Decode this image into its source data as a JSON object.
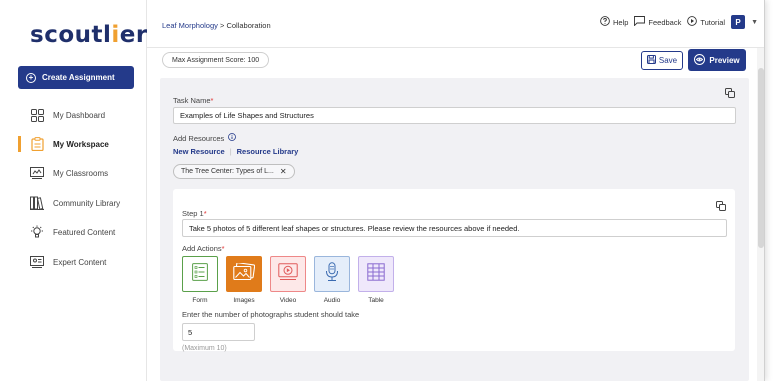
{
  "app": {
    "logo_text": "scoutlier"
  },
  "sidebar": {
    "create_label": "Create Assignment",
    "items": [
      {
        "label": "My Dashboard",
        "icon": "grid-icon",
        "active": false
      },
      {
        "label": "My Workspace",
        "icon": "clipboard-icon",
        "active": true
      },
      {
        "label": "My Classrooms",
        "icon": "classroom-icon",
        "active": false
      },
      {
        "label": "Community Library",
        "icon": "library-icon",
        "active": false
      },
      {
        "label": "Featured Content",
        "icon": "lightbulb-icon",
        "active": false
      },
      {
        "label": "Expert Content",
        "icon": "expert-icon",
        "active": false
      }
    ]
  },
  "header": {
    "breadcrumb_link": "Leaf Morphology",
    "breadcrumb_sep": ">",
    "breadcrumb_current": "Collaboration",
    "help_label": "Help",
    "feedback_label": "Feedback",
    "tutorial_label": "Tutorial",
    "avatar_initial": "P"
  },
  "toolbar": {
    "max_score_label": "Max Assignment Score: 100",
    "save_label": "Save",
    "preview_label": "Preview"
  },
  "task": {
    "name_label": "Task Name",
    "name_value": "Examples of Life Shapes and Structures",
    "add_resources_label": "Add Resources",
    "new_resource_label": "New Resource",
    "resource_library_label": "Resource Library",
    "chip_label": "The Tree Center: Types of L..."
  },
  "step": {
    "label": "Step 1",
    "prompt": "Take 5 photos of 5 different leaf shapes or structures. Please review the resources above if needed.",
    "add_actions_label": "Add Actions",
    "actions": [
      {
        "label": "Form",
        "icon": "form-icon",
        "color": "#5aa04a",
        "bg": "#ffffff",
        "selected": false
      },
      {
        "label": "Images",
        "icon": "images-icon",
        "color": "#ffffff",
        "bg": "#e07b1a",
        "selected": true
      },
      {
        "label": "Video",
        "icon": "video-icon",
        "color": "#e05a5a",
        "bg": "#fde8e8",
        "selected": false
      },
      {
        "label": "Audio",
        "icon": "audio-icon",
        "color": "#3a6ab0",
        "bg": "#e5eefa",
        "selected": false
      },
      {
        "label": "Table",
        "icon": "table-icon",
        "color": "#8a6ad0",
        "bg": "#efe8fb",
        "selected": false
      }
    ],
    "photo_count_label": "Enter the number of photographs student should take",
    "photo_count_value": "5",
    "max_note": "(Maximum 10)"
  },
  "colors": {
    "brand": "#243a8a",
    "accent": "#f0a030",
    "required": "#e03030"
  }
}
